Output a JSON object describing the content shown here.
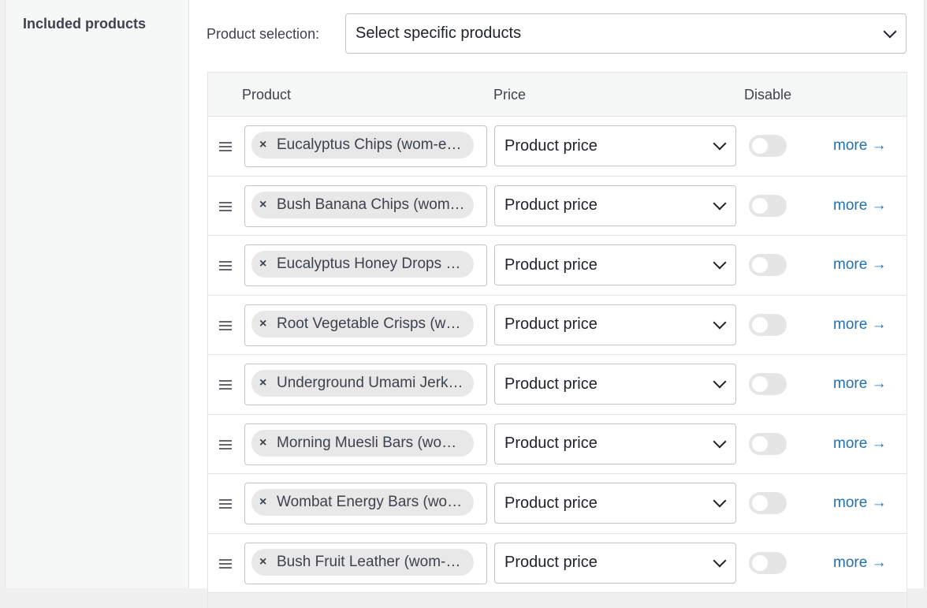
{
  "section": {
    "label": "Included products"
  },
  "product_selection": {
    "label": "Product selection:",
    "value": "Select specific products"
  },
  "table": {
    "headers": {
      "product": "Product",
      "price": "Price",
      "disable": "Disable"
    },
    "rows": [
      {
        "product": "Eucalyptus Chips (wom-e…",
        "price": "Product price",
        "more": "more →"
      },
      {
        "product": "Bush Banana Chips (wom…",
        "price": "Product price",
        "more": "more →"
      },
      {
        "product": "Eucalyptus Honey Drops …",
        "price": "Product price",
        "more": "more →"
      },
      {
        "product": "Root Vegetable Crisps (w…",
        "price": "Product price",
        "more": "more →"
      },
      {
        "product": "Underground Umami Jerk…",
        "price": "Product price",
        "more": "more →"
      },
      {
        "product": "Morning Muesli Bars (wo…",
        "price": "Product price",
        "more": "more →"
      },
      {
        "product": "Wombat Energy Bars (wo…",
        "price": "Product price",
        "more": "more →"
      },
      {
        "product": "Bush Fruit Leather (wom-…",
        "price": "Product price",
        "more": "more →"
      }
    ]
  },
  "colors": {
    "link": "#2271b1",
    "toggle_off": "#e5e5e5",
    "chip": "#e8e8e9"
  },
  "icons": {
    "remove": "x-icon",
    "drag": "drag-handle-icon",
    "dropdown": "chevron-down-icon",
    "arrow": "arrow-right-icon"
  }
}
